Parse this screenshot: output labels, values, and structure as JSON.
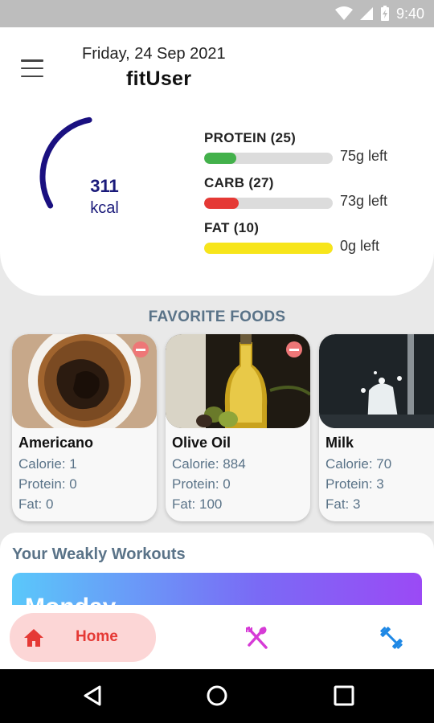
{
  "status_bar": {
    "time": "9:40"
  },
  "header": {
    "date": "Friday, 24 Sep 2021",
    "user": "fitUser",
    "calories": {
      "value": "311",
      "unit": "kcal",
      "arc_fill": 0.42
    },
    "macros": [
      {
        "label": "PROTEIN (25)",
        "left_text": "75g left",
        "color": "#43b14b",
        "fill": 0.25
      },
      {
        "label": "CARB (27)",
        "left_text": "73g left",
        "color": "#e53935",
        "fill": 0.27
      },
      {
        "label": "FAT (10)",
        "left_text": "0g left",
        "color": "#f7e51b",
        "fill": 1.0
      }
    ]
  },
  "favorites": {
    "title": "FAVORITE FOODS",
    "items": [
      {
        "name": "Americano",
        "calorie": "Calorie: 1",
        "protein": "Protein: 0",
        "fat": "Fat: 0",
        "image": "coffee-cup"
      },
      {
        "name": "Olive Oil",
        "calorie": "Calorie: 884",
        "protein": "Protein: 0",
        "fat": "Fat: 100",
        "image": "olive-oil-bottle"
      },
      {
        "name": "Milk",
        "calorie": "Calorie: 70",
        "protein": "Protein: 3",
        "fat": "Fat: 3",
        "image": "milk-splash"
      }
    ]
  },
  "workouts": {
    "title": "Your Weakly Workouts",
    "day": "Monday"
  },
  "bottom_nav": {
    "home_label": "Home",
    "accent": "#e53935",
    "food_icon_color": "#d63bd6",
    "workout_icon_color": "#1e88e5"
  }
}
